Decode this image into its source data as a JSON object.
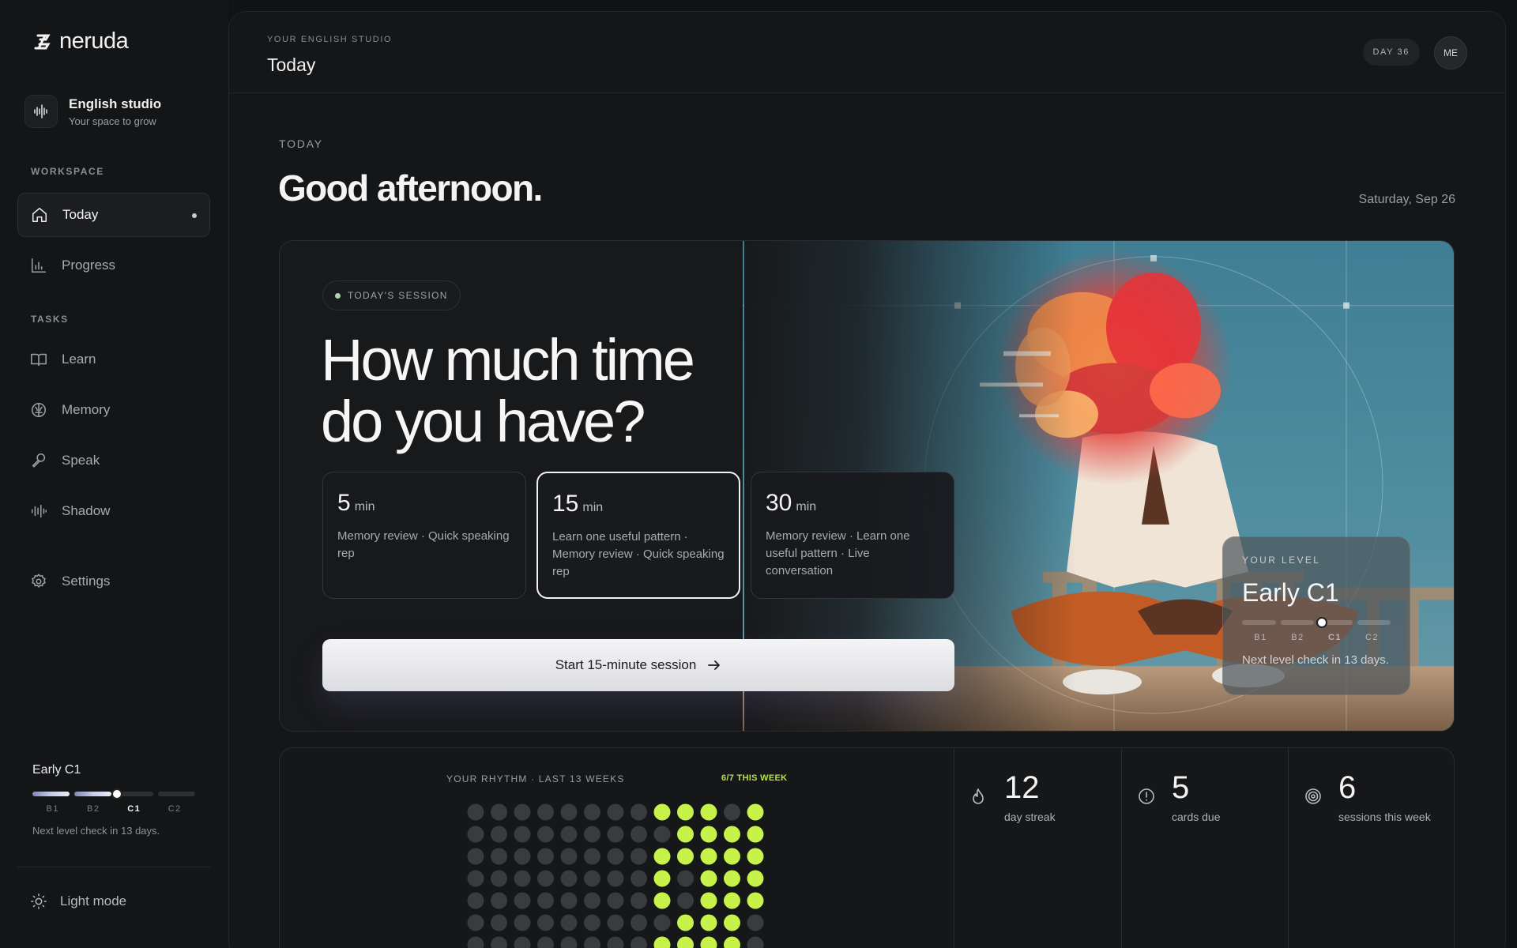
{
  "app": {
    "name": "neruda"
  },
  "studio": {
    "title": "English studio",
    "subtitle": "Your space to grow"
  },
  "sidebar": {
    "workspace_label": "WORKSPACE",
    "tasks_label": "TASKS",
    "workspace_items": [
      {
        "label": "Today",
        "icon": "home-icon",
        "active": true
      },
      {
        "label": "Progress",
        "icon": "bar-chart-icon"
      }
    ],
    "task_items": [
      {
        "label": "Learn",
        "icon": "book-icon"
      },
      {
        "label": "Memory",
        "icon": "brain-icon"
      },
      {
        "label": "Speak",
        "icon": "microphone-icon"
      },
      {
        "label": "Shadow",
        "icon": "waveform-icon"
      }
    ],
    "settings_label": "Settings",
    "level": {
      "title": "Early C1",
      "ticks": [
        "B1",
        "B2",
        "C1",
        "C2"
      ],
      "current": "C1",
      "progress": 0.53,
      "hint": "Next level check in 13 days."
    },
    "light_mode_label": "Light mode"
  },
  "topbar": {
    "eyebrow": "YOUR ENGLISH STUDIO",
    "title": "Today",
    "day_label": "DAY 36",
    "avatar": "ME"
  },
  "header": {
    "today_label": "TODAY",
    "greeting": "Good afternoon.",
    "date": "Saturday, Sep 26"
  },
  "hero": {
    "pill": "TODAY'S SESSION",
    "question_line1": "How much time",
    "question_line2": "do you have?",
    "options": [
      {
        "num": "5",
        "unit": "min",
        "desc": "Memory review · Quick speaking rep"
      },
      {
        "num": "15",
        "unit": "min",
        "desc": "Learn one useful pattern · Memory review · Quick speaking rep",
        "selected": true
      },
      {
        "num": "30",
        "unit": "min",
        "desc": "Memory review · Learn one useful pattern · Live conversation"
      }
    ],
    "start_label": "Start 15-minute session",
    "level_card": {
      "eyebrow": "YOUR LEVEL",
      "title": "Early C1",
      "ticks": [
        "B1",
        "B2",
        "C1",
        "C2"
      ],
      "progress": 0.53,
      "hint": "Next level check in 13 days."
    }
  },
  "rhythm": {
    "label": "YOUR RHYTHM · LAST 13 WEEKS",
    "this_week": "6/7 THIS WEEK",
    "accent": "#c6f24a",
    "grid": [
      [
        0,
        0,
        0,
        0,
        0,
        0,
        0,
        0,
        1,
        1,
        1,
        0,
        1
      ],
      [
        0,
        0,
        0,
        0,
        0,
        0,
        0,
        0,
        0,
        1,
        1,
        1,
        1
      ],
      [
        0,
        0,
        0,
        0,
        0,
        0,
        0,
        0,
        1,
        1,
        1,
        1,
        1
      ],
      [
        0,
        0,
        0,
        0,
        0,
        0,
        0,
        0,
        1,
        0,
        1,
        1,
        1
      ],
      [
        0,
        0,
        0,
        0,
        0,
        0,
        0,
        0,
        1,
        0,
        1,
        1,
        1
      ],
      [
        0,
        0,
        0,
        0,
        0,
        0,
        0,
        0,
        0,
        1,
        1,
        1,
        0
      ],
      [
        0,
        0,
        0,
        0,
        0,
        0,
        0,
        0,
        1,
        1,
        1,
        1,
        0
      ]
    ]
  },
  "stats": [
    {
      "value": "12",
      "label": "day streak",
      "icon": "flame-icon"
    },
    {
      "value": "5",
      "label": "cards due",
      "icon": "alert-circle-icon"
    },
    {
      "value": "6",
      "label": "sessions this week",
      "icon": "target-icon"
    }
  ]
}
